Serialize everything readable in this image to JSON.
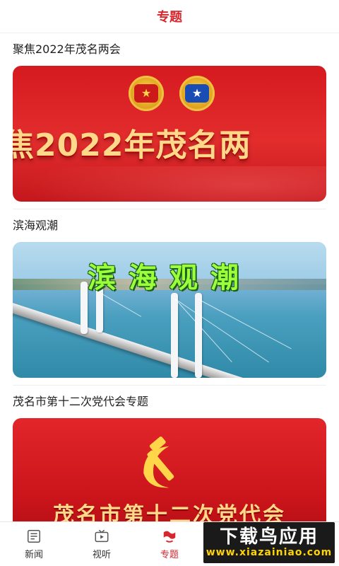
{
  "header": {
    "title": "专题"
  },
  "sections": [
    {
      "title": "聚焦2022年茂名两会",
      "banner_text": "焦2022年茂名两"
    },
    {
      "title": "滨海观潮",
      "banner_text": "滨海观潮"
    },
    {
      "title": "茂名市第十二次党代会专题",
      "banner_text": "茂名市第十二次党代会"
    }
  ],
  "tabs": [
    {
      "label": "新闻",
      "icon": "newspaper-icon"
    },
    {
      "label": "视听",
      "icon": "tv-icon"
    },
    {
      "label": "专题",
      "icon": "topic-icon",
      "active": true
    }
  ],
  "watermark": {
    "main": "下载鸟应用",
    "sub": "www.xiazainiao.com"
  },
  "colors": {
    "accent": "#d7262d",
    "banner_red": "#d51a1f",
    "sea_text": "#9bff3a"
  }
}
